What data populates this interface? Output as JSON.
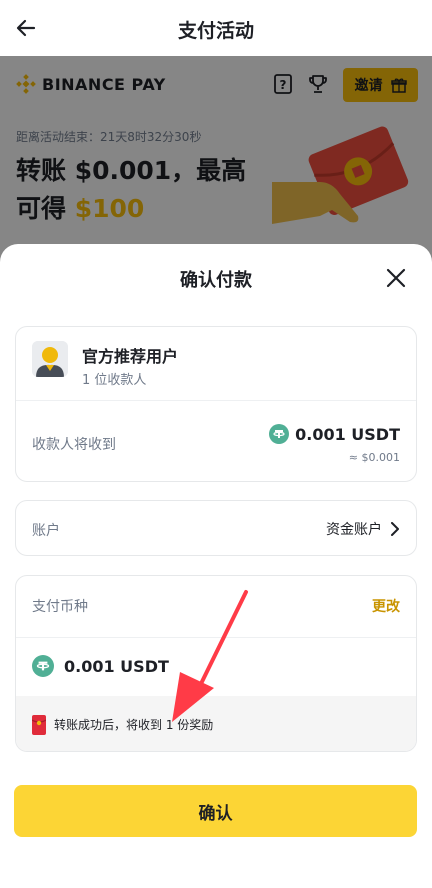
{
  "header": {
    "title": "支付活动"
  },
  "banner": {
    "logo_text": "BINANCE PAY",
    "invite_label": "邀请",
    "countdown": "距离活动结束：21天8时32分30秒",
    "headline_line1": "转账 $0.001，最高",
    "headline_line2_prefix": "可得 ",
    "headline_line2_highlight": "$100"
  },
  "sheet": {
    "title": "确认付款",
    "recipient": {
      "name": "官方推荐用户",
      "count": "1 位收款人"
    },
    "receive": {
      "label": "收款人将收到",
      "amount": "0.001 USDT",
      "usd": "≈ $0.001"
    },
    "account": {
      "label": "账户",
      "value": "资金账户"
    },
    "payment": {
      "label": "支付币种",
      "change": "更改",
      "coin_amount": "0.001 USDT",
      "reward_note": "转账成功后，将收到 1 份奖励"
    },
    "confirm_label": "确认"
  },
  "colors": {
    "brand": "#f0b90b",
    "button": "#fcd535",
    "usdt": "#50af95",
    "arrow": "#ff3b47"
  }
}
